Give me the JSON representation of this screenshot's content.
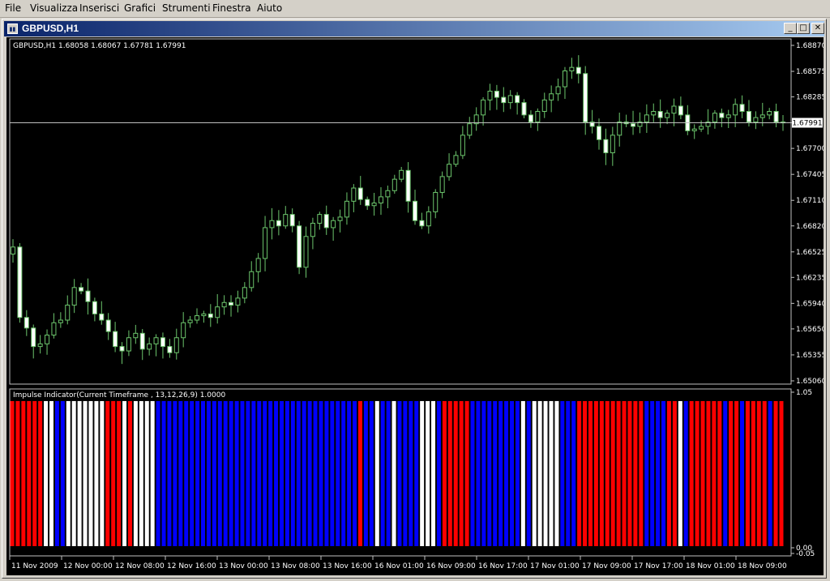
{
  "menu": [
    "File",
    "Visualizza",
    "Inserisci",
    "Grafici",
    "Strumenti",
    "Finestra",
    "Aiuto"
  ],
  "window": {
    "title": "GBPUSD,H1",
    "min_glyph": "_",
    "max_glyph": "□",
    "close_glyph": "✕"
  },
  "colors": {
    "background": "#000000",
    "axis": "#c0c0c0",
    "candle": "#6cc56c",
    "bull_body": "#000000",
    "bear_body": "#ffffff",
    "price_line": "#c0c0c0",
    "impulse_red": "#ff0000",
    "impulse_blue": "#0000ff",
    "impulse_white": "#ffffff"
  },
  "chart_data": [
    {
      "type": "candlestick",
      "title": "GBPUSD,H1  1.68058 1.68067 1.67781 1.67991",
      "symbol": "GBPUSD,H1",
      "last_quote": {
        "open": 1.68058,
        "high": 1.68067,
        "low": 1.67781,
        "close": 1.67991
      },
      "current_price_label": "1.67991",
      "current_price": 1.67991,
      "ylim": [
        1.6506,
        1.6887
      ],
      "yticks": [
        "1.68870",
        "1.68575",
        "1.68285",
        "1.67991",
        "1.67700",
        "1.67405",
        "1.67110",
        "1.66820",
        "1.66525",
        "1.66235",
        "1.65940",
        "1.65650",
        "1.65355",
        "1.65060"
      ],
      "xticks": [
        "11 Nov 2009",
        "12 Nov 00:00",
        "12 Nov 08:00",
        "12 Nov 16:00",
        "13 Nov 00:00",
        "13 Nov 08:00",
        "13 Nov 16:00",
        "16 Nov 01:00",
        "16 Nov 09:00",
        "16 Nov 17:00",
        "17 Nov 01:00",
        "17 Nov 09:00",
        "17 Nov 17:00",
        "18 Nov 01:00",
        "18 Nov 09:00"
      ],
      "close_path": [
        1.6658,
        1.6578,
        1.6566,
        1.6545,
        1.6548,
        1.6558,
        1.6572,
        1.6575,
        1.6592,
        1.6612,
        1.6608,
        1.6596,
        1.6582,
        1.6575,
        1.6562,
        1.6545,
        1.654,
        1.6555,
        1.656,
        1.6542,
        1.6548,
        1.6555,
        1.6545,
        1.6538,
        1.6555,
        1.6572,
        1.6575,
        1.658,
        1.6582,
        1.6578,
        1.659,
        1.6595,
        1.6592,
        1.66,
        1.6612,
        1.663,
        1.6645,
        1.668,
        1.6688,
        1.6682,
        1.6695,
        1.6682,
        1.6635,
        1.667,
        1.6685,
        1.6695,
        1.668,
        1.6688,
        1.6692,
        1.671,
        1.6725,
        1.6712,
        1.6705,
        1.6708,
        1.6715,
        1.6722,
        1.6735,
        1.6745,
        1.671,
        1.6688,
        1.6682,
        1.6698,
        1.672,
        1.6738,
        1.6752,
        1.6762,
        1.6785,
        1.6798,
        1.6808,
        1.6825,
        1.6835,
        1.6828,
        1.6822,
        1.683,
        1.6822,
        1.6808,
        1.68,
        1.6812,
        1.6825,
        1.6832,
        1.684,
        1.6858,
        1.6862,
        1.6855,
        1.68,
        1.6795,
        1.678,
        1.6765,
        1.6785,
        1.68,
        1.6798,
        1.6795,
        1.68,
        1.6808,
        1.6812,
        1.6805,
        1.681,
        1.6818,
        1.6808,
        1.679,
        1.6792,
        1.6795,
        1.68,
        1.681,
        1.6805,
        1.6808,
        1.682,
        1.6812,
        1.68,
        1.6805,
        1.6808,
        1.6812,
        1.68,
        1.6799
      ],
      "label": "Impulse Indicator(Current Timeframe , 13,12,26,9) 1.0000"
    },
    {
      "type": "bar",
      "title": "Impulse Indicator(Current Timeframe , 13,12,26,9) 1.0000",
      "ylim": [
        0,
        1.05
      ],
      "yticks": [
        "1.05",
        "0.00",
        "-0.05"
      ],
      "bar_value": 1.0,
      "colors_sequence": "RRRRRRWWBBWWWWWWWRRRWRWWWWBBBBBBBBBBBBBBBBBBBBBBBBBBBBBBBBBBBBRBBWBBWBBBBWWWBRRRRRBBBBBBBBBWBWWWWWBBBRRRRRRRRRRRRBBBBRRWBRRRRRRBRRBRRRRBRR"
    }
  ]
}
